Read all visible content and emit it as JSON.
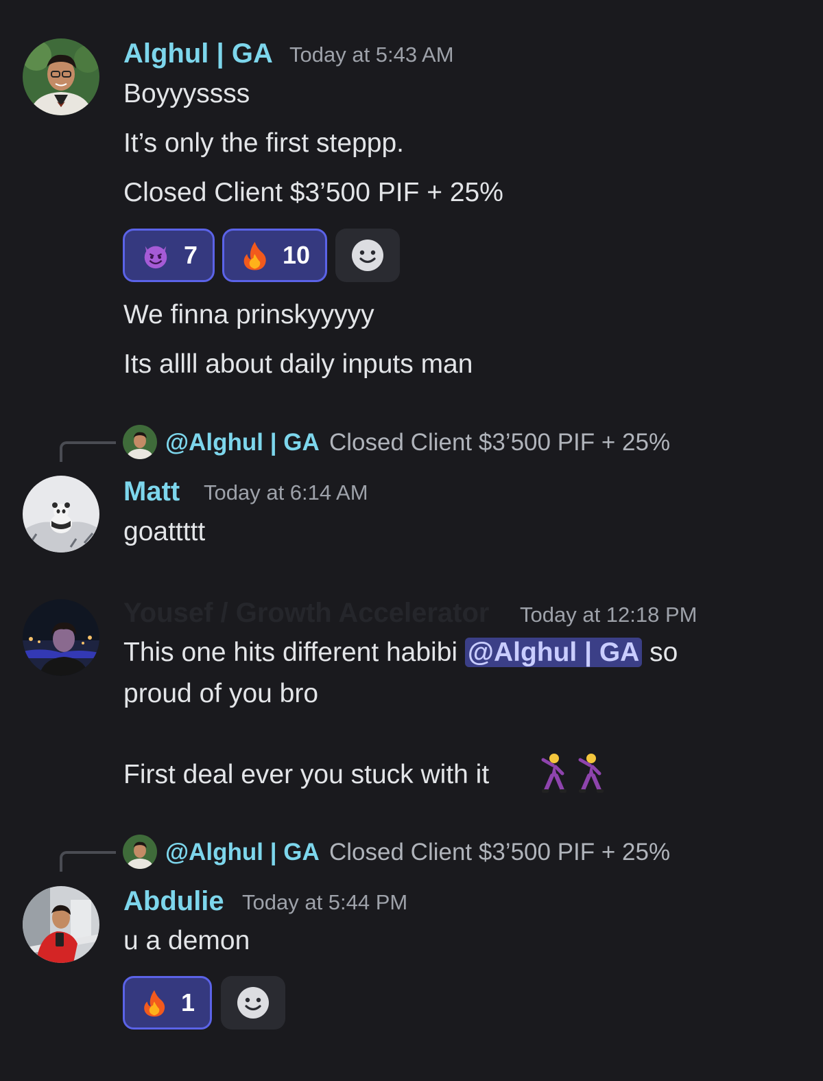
{
  "messages": [
    {
      "author": "Alghul | GA",
      "timestamp": "Today at 5:43 AM",
      "lines": [
        "Boyyyssss",
        "It’s only the first steppp.",
        "Closed Client $3’500 PIF + 25%"
      ],
      "reactions": [
        {
          "emoji": "smiling-imp",
          "count": "7"
        },
        {
          "emoji": "fire",
          "count": "10"
        }
      ],
      "after_lines": [
        "We finna prinskyyyyy",
        "Its allll about daily inputs man"
      ]
    },
    {
      "reply": {
        "mention": "@Alghul | GA",
        "text": "Closed Client $3’500 PIF + 25%"
      },
      "author": "Matt",
      "timestamp": "Today at 6:14 AM",
      "lines": [
        "goattttt"
      ]
    },
    {
      "author": "Yousef / Growth Accelerator",
      "timestamp": "Today at 12:18 PM",
      "line1_before": "This one hits different habibi ",
      "mention": "@Alghul | GA",
      "line1_after": " so",
      "line2": "proud of you bro",
      "line3": "First deal ever you stuck with it"
    },
    {
      "reply": {
        "mention": "@Alghul | GA",
        "text": "Closed Client $3’500 PIF + 25%"
      },
      "author": "Abdulie",
      "timestamp": "Today at 5:44 PM",
      "lines": [
        "u a demon"
      ],
      "reactions": [
        {
          "emoji": "fire",
          "count": "1"
        }
      ]
    }
  ],
  "colors": {
    "background": "#1a1a1e",
    "username": "#7dd6ec",
    "reaction_bg": "#35397f",
    "reaction_border": "#5b63e8"
  }
}
